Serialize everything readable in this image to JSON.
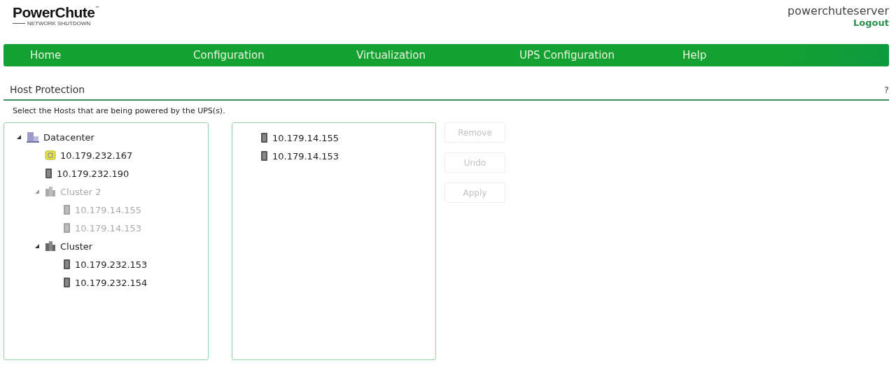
{
  "logo": {
    "name": "PowerChute",
    "trademark": "™",
    "tagline": "NETWORK SHUTDOWN"
  },
  "user": {
    "name": "powerchuteserver",
    "logout": "Logout"
  },
  "nav": [
    {
      "label": "Home"
    },
    {
      "label": "Configuration"
    },
    {
      "label": "Virtualization"
    },
    {
      "label": "UPS Configuration"
    },
    {
      "label": "Help"
    }
  ],
  "page": {
    "title": "Host Protection",
    "help": "?",
    "instruction": "Select the Hosts that are being powered by the UPS(s)."
  },
  "tree": [
    {
      "kind": "datacenter",
      "label": "Datacenter",
      "expanded": true,
      "disabled": false,
      "children": [
        {
          "kind": "vapp",
          "label": "10.179.232.167",
          "disabled": false
        },
        {
          "kind": "host",
          "label": "10.179.232.190",
          "disabled": false
        },
        {
          "kind": "cluster",
          "label": "Cluster 2",
          "expanded": true,
          "disabled": true,
          "children": [
            {
              "kind": "host",
              "label": "10.179.14.155",
              "disabled": true
            },
            {
              "kind": "host",
              "label": "10.179.14.153",
              "disabled": true
            }
          ]
        },
        {
          "kind": "cluster",
          "label": "Cluster",
          "expanded": true,
          "disabled": false,
          "children": [
            {
              "kind": "host",
              "label": "10.179.232.153",
              "disabled": false
            },
            {
              "kind": "host",
              "label": "10.179.232.154",
              "disabled": false
            }
          ]
        }
      ]
    }
  ],
  "selected_hosts": [
    {
      "kind": "host",
      "label": "10.179.14.155"
    },
    {
      "kind": "host",
      "label": "10.179.14.153"
    }
  ],
  "buttons": [
    {
      "label": "Remove",
      "disabled": true
    },
    {
      "label": "Undo",
      "disabled": true
    },
    {
      "label": "Apply",
      "disabled": true
    }
  ]
}
